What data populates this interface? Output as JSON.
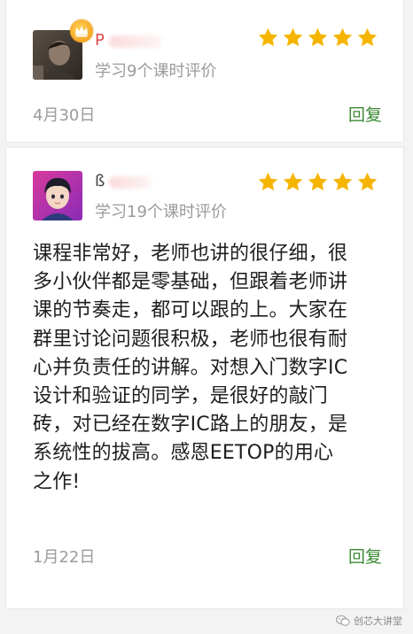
{
  "reviews": [
    {
      "name_visible": "P",
      "sub_label": "学习9个课时评价",
      "date": "4月30日",
      "reply_label": "回复",
      "rating": 5,
      "content_lines": []
    },
    {
      "name_visible": "ß",
      "sub_label": "学习19个课时评价",
      "date": "1月22日",
      "reply_label": "回复",
      "rating": 5,
      "content_lines": [
        "课程非常好，老师也讲的很仔细，很",
        "多小伙伴都是零基础，但跟着老师讲",
        "课的节奏走，都可以跟的上。大家在",
        "群里讨论问题很积极，老师也很有耐",
        "心并负责任的讲解。对想入门数字IC",
        "设计和验证的同学，是很好的敲门",
        "砖，对已经在数字IC路上的朋友，是",
        "系统性的拔高。感恩EETOP的用心",
        "之作!"
      ]
    }
  ],
  "watermark": {
    "label": "创芯大讲堂"
  },
  "colors": {
    "star": "#f5b400",
    "reply": "#3c8a34",
    "muted": "#9b9b9b",
    "name": "#e24a4a",
    "text": "#1e1e1e"
  },
  "icons": [
    "crown-icon",
    "star-icon",
    "wechat-icon"
  ]
}
